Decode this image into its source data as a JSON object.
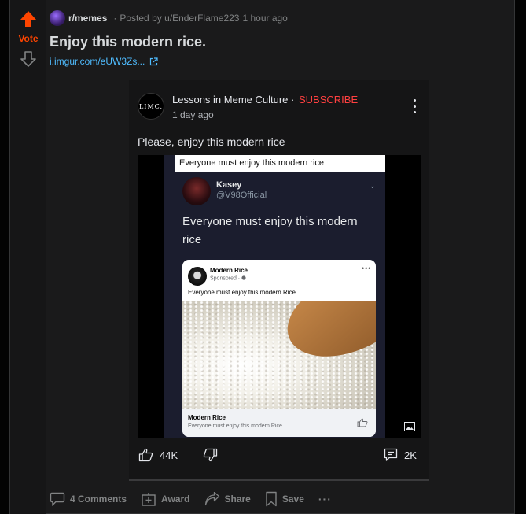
{
  "vote": {
    "label": "Vote"
  },
  "post": {
    "subreddit": "r/memes",
    "posted_by": "Posted by u/EnderFlame223",
    "time": "1 hour ago",
    "title": "Enjoy this modern rice.",
    "link": "i.imgur.com/eUW3Zs..."
  },
  "embed": {
    "avatar_text": "LIMC.",
    "page_name": "Lessons in Meme Culture",
    "subscribe": "SUBSCRIBE",
    "time": "1 day ago",
    "caption": "Please, enjoy this modern rice",
    "media": {
      "banner": "Everyone must enjoy this modern rice",
      "tweet": {
        "name": "Kasey",
        "handle": "@V98Official",
        "text": "Everyone must enjoy this modern rice"
      },
      "fb_card": {
        "name": "Modern Rice",
        "sponsored": "Sponsored · ",
        "text": "Everyone must enjoy this modern Rice",
        "footer_title": "Modern Rice",
        "footer_sub": "Everyone must enjoy this modern Rice"
      }
    },
    "likes": "44K",
    "comments": "2K"
  },
  "footer": {
    "comments": "4 Comments",
    "award": "Award",
    "share": "Share",
    "save": "Save",
    "more": "···"
  },
  "colors": {
    "upvote": "#ff4500",
    "link": "#4fbcff",
    "subscribe": "#ff4040"
  }
}
